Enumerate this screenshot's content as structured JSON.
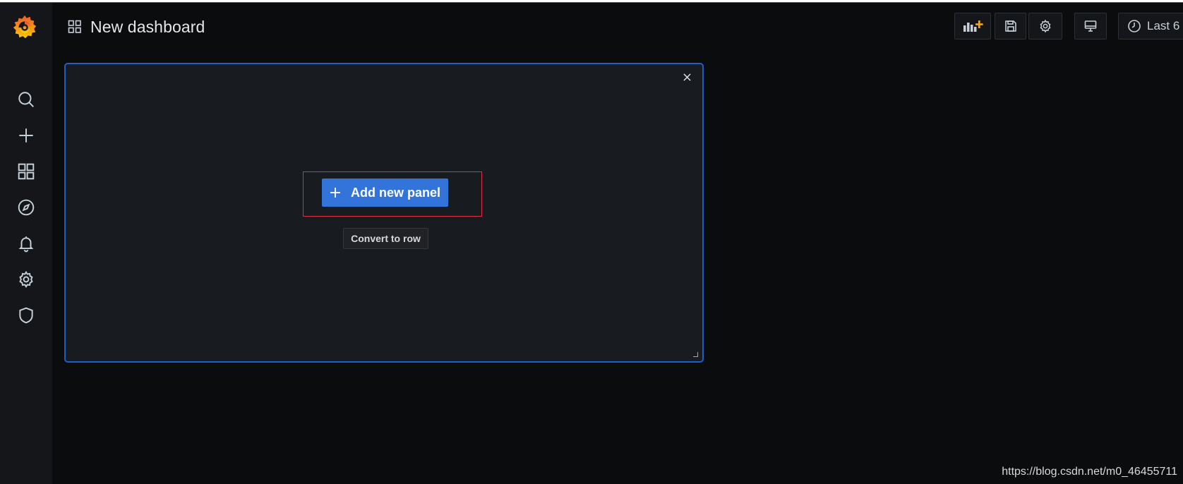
{
  "header": {
    "title": "New dashboard",
    "time_range_label": "Last 6"
  },
  "icons": {
    "logo": "grafana-logo",
    "sidebar": [
      "search-icon",
      "plus-icon",
      "dashboards-icon",
      "explore-icon",
      "alerting-icon",
      "gear-icon",
      "shield-icon"
    ],
    "toolbar": [
      "add-panel-icon",
      "save-icon",
      "gear-icon",
      "tv-icon",
      "clock-icon"
    ]
  },
  "panel": {
    "add_button_label": "Add new panel",
    "convert_button_label": "Convert to row"
  },
  "watermark": "https://blog.csdn.net/m0_46455711",
  "colors": {
    "accent_blue": "#3274d9",
    "panel_border": "#1f5fc4",
    "highlight_red": "#e02f44",
    "logo_orange": "#f46800"
  }
}
